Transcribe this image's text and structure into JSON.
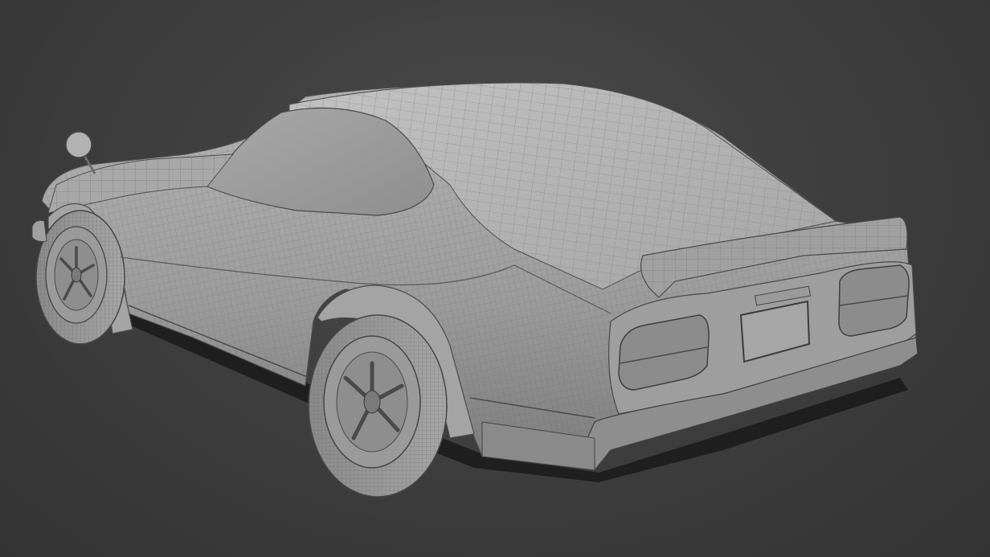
{
  "viewport": {
    "background_color": "#3e3e3e",
    "model_color": "#9a9a9a",
    "wire_color": "#555555",
    "shadow_color": "#1c1c1c"
  },
  "model": {
    "subject": "car-wireframe-model"
  }
}
